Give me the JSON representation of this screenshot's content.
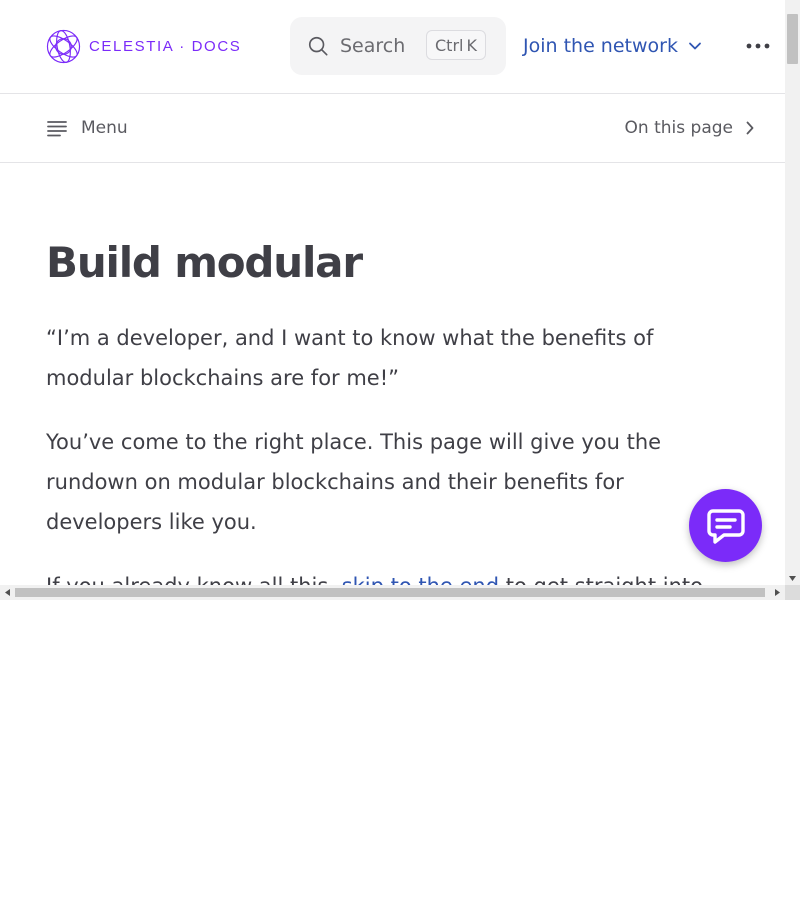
{
  "header": {
    "logo_text": "CELESTIA · DOCS",
    "search": {
      "label": "Search",
      "shortcut_ctrl": "Ctrl",
      "shortcut_key": "K"
    },
    "network_menu_label": "Join the network",
    "more_icon": "ellipsis-icon"
  },
  "subheader": {
    "menu_label": "Menu",
    "toc_label": "On this page"
  },
  "content": {
    "title": "Build modular",
    "paragraph_1": "“I’m a developer, and I want to know what the benefits of modular blockchains are for me!”",
    "paragraph_2": "You’ve come to the right place. This page will give you the rundown on modular blockchains and their benefits for developers like you.",
    "paragraph_3_before": "If you already know all this, ",
    "paragraph_3_link": "skip to the end",
    "paragraph_3_after": " to get straight into"
  },
  "chat_button_icon": "chat-icon",
  "colors": {
    "brand": "#7b2bf9",
    "link": "#2f55b2",
    "text": "#3f3f46",
    "muted": "#5a5a60"
  }
}
